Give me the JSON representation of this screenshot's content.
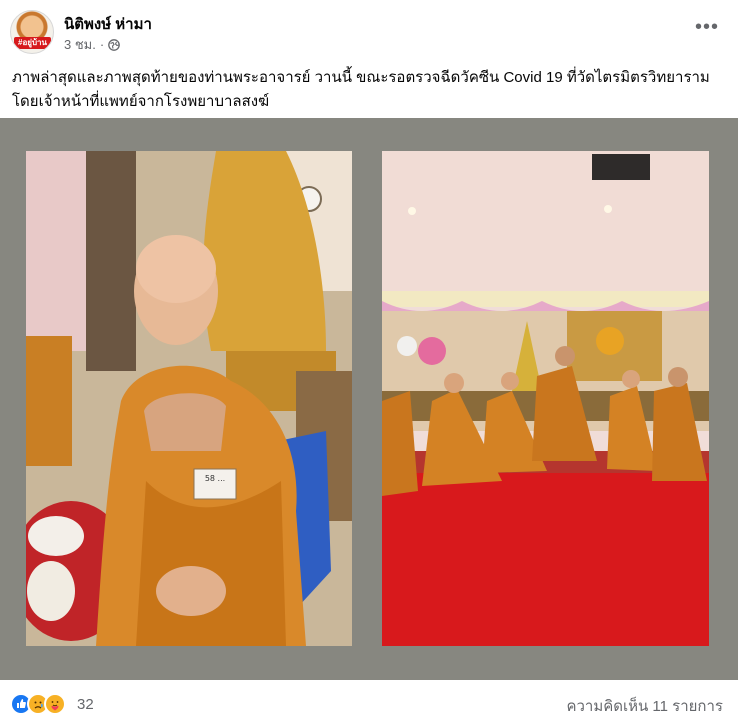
{
  "post": {
    "author": "นิติพงษ์ ห่ามา",
    "time": "3 ชม.",
    "separator": "·",
    "more_icon": "more-horizontal-icon",
    "privacy_icon": "globe-icon",
    "avatar_badge": "#อยู่บ้าน",
    "caption": "ภาพล่าสุดและภาพสุดท้ายของท่านพระอาจารย์ วานนี้ ขณะรอตรวจฉีดวัคซีน Covid 19 ที่วัดไตรมิตรวิทยาราม โดยเจ้าหน้าที่แพทย์จากโรงพยาบาลสงฆ์"
  },
  "photos": {
    "left_nametag": "58 ...",
    "frame_color": "#878780"
  },
  "footer": {
    "reaction_icons": [
      "like-icon",
      "sad-icon",
      "care-icon"
    ],
    "reaction_count": "32",
    "comment_count": "ความคิดเห็น 11 รายการ"
  },
  "colors": {
    "robe": "#d9892a",
    "carpet": "#d8191c",
    "like_blue": "#1877f2"
  }
}
